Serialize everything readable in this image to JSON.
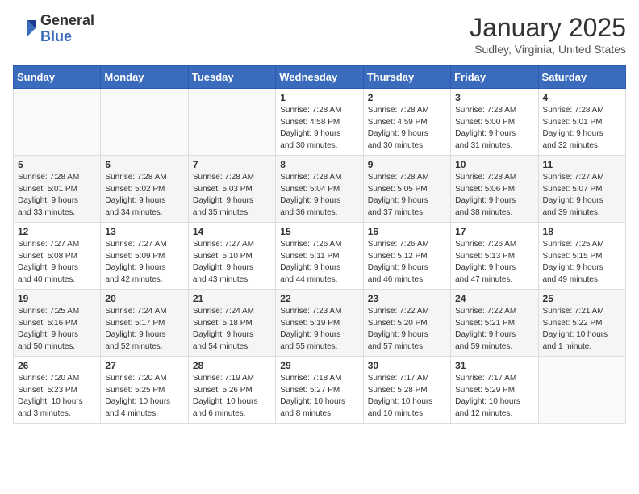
{
  "logo": {
    "general": "General",
    "blue": "Blue"
  },
  "title": "January 2025",
  "location": "Sudley, Virginia, United States",
  "days_of_week": [
    "Sunday",
    "Monday",
    "Tuesday",
    "Wednesday",
    "Thursday",
    "Friday",
    "Saturday"
  ],
  "weeks": [
    [
      {
        "day": "",
        "info": ""
      },
      {
        "day": "",
        "info": ""
      },
      {
        "day": "",
        "info": ""
      },
      {
        "day": "1",
        "info": "Sunrise: 7:28 AM\nSunset: 4:58 PM\nDaylight: 9 hours\nand 30 minutes."
      },
      {
        "day": "2",
        "info": "Sunrise: 7:28 AM\nSunset: 4:59 PM\nDaylight: 9 hours\nand 30 minutes."
      },
      {
        "day": "3",
        "info": "Sunrise: 7:28 AM\nSunset: 5:00 PM\nDaylight: 9 hours\nand 31 minutes."
      },
      {
        "day": "4",
        "info": "Sunrise: 7:28 AM\nSunset: 5:01 PM\nDaylight: 9 hours\nand 32 minutes."
      }
    ],
    [
      {
        "day": "5",
        "info": "Sunrise: 7:28 AM\nSunset: 5:01 PM\nDaylight: 9 hours\nand 33 minutes."
      },
      {
        "day": "6",
        "info": "Sunrise: 7:28 AM\nSunset: 5:02 PM\nDaylight: 9 hours\nand 34 minutes."
      },
      {
        "day": "7",
        "info": "Sunrise: 7:28 AM\nSunset: 5:03 PM\nDaylight: 9 hours\nand 35 minutes."
      },
      {
        "day": "8",
        "info": "Sunrise: 7:28 AM\nSunset: 5:04 PM\nDaylight: 9 hours\nand 36 minutes."
      },
      {
        "day": "9",
        "info": "Sunrise: 7:28 AM\nSunset: 5:05 PM\nDaylight: 9 hours\nand 37 minutes."
      },
      {
        "day": "10",
        "info": "Sunrise: 7:28 AM\nSunset: 5:06 PM\nDaylight: 9 hours\nand 38 minutes."
      },
      {
        "day": "11",
        "info": "Sunrise: 7:27 AM\nSunset: 5:07 PM\nDaylight: 9 hours\nand 39 minutes."
      }
    ],
    [
      {
        "day": "12",
        "info": "Sunrise: 7:27 AM\nSunset: 5:08 PM\nDaylight: 9 hours\nand 40 minutes."
      },
      {
        "day": "13",
        "info": "Sunrise: 7:27 AM\nSunset: 5:09 PM\nDaylight: 9 hours\nand 42 minutes."
      },
      {
        "day": "14",
        "info": "Sunrise: 7:27 AM\nSunset: 5:10 PM\nDaylight: 9 hours\nand 43 minutes."
      },
      {
        "day": "15",
        "info": "Sunrise: 7:26 AM\nSunset: 5:11 PM\nDaylight: 9 hours\nand 44 minutes."
      },
      {
        "day": "16",
        "info": "Sunrise: 7:26 AM\nSunset: 5:12 PM\nDaylight: 9 hours\nand 46 minutes."
      },
      {
        "day": "17",
        "info": "Sunrise: 7:26 AM\nSunset: 5:13 PM\nDaylight: 9 hours\nand 47 minutes."
      },
      {
        "day": "18",
        "info": "Sunrise: 7:25 AM\nSunset: 5:15 PM\nDaylight: 9 hours\nand 49 minutes."
      }
    ],
    [
      {
        "day": "19",
        "info": "Sunrise: 7:25 AM\nSunset: 5:16 PM\nDaylight: 9 hours\nand 50 minutes."
      },
      {
        "day": "20",
        "info": "Sunrise: 7:24 AM\nSunset: 5:17 PM\nDaylight: 9 hours\nand 52 minutes."
      },
      {
        "day": "21",
        "info": "Sunrise: 7:24 AM\nSunset: 5:18 PM\nDaylight: 9 hours\nand 54 minutes."
      },
      {
        "day": "22",
        "info": "Sunrise: 7:23 AM\nSunset: 5:19 PM\nDaylight: 9 hours\nand 55 minutes."
      },
      {
        "day": "23",
        "info": "Sunrise: 7:22 AM\nSunset: 5:20 PM\nDaylight: 9 hours\nand 57 minutes."
      },
      {
        "day": "24",
        "info": "Sunrise: 7:22 AM\nSunset: 5:21 PM\nDaylight: 9 hours\nand 59 minutes."
      },
      {
        "day": "25",
        "info": "Sunrise: 7:21 AM\nSunset: 5:22 PM\nDaylight: 10 hours\nand 1 minute."
      }
    ],
    [
      {
        "day": "26",
        "info": "Sunrise: 7:20 AM\nSunset: 5:23 PM\nDaylight: 10 hours\nand 3 minutes."
      },
      {
        "day": "27",
        "info": "Sunrise: 7:20 AM\nSunset: 5:25 PM\nDaylight: 10 hours\nand 4 minutes."
      },
      {
        "day": "28",
        "info": "Sunrise: 7:19 AM\nSunset: 5:26 PM\nDaylight: 10 hours\nand 6 minutes."
      },
      {
        "day": "29",
        "info": "Sunrise: 7:18 AM\nSunset: 5:27 PM\nDaylight: 10 hours\nand 8 minutes."
      },
      {
        "day": "30",
        "info": "Sunrise: 7:17 AM\nSunset: 5:28 PM\nDaylight: 10 hours\nand 10 minutes."
      },
      {
        "day": "31",
        "info": "Sunrise: 7:17 AM\nSunset: 5:29 PM\nDaylight: 10 hours\nand 12 minutes."
      },
      {
        "day": "",
        "info": ""
      }
    ]
  ]
}
